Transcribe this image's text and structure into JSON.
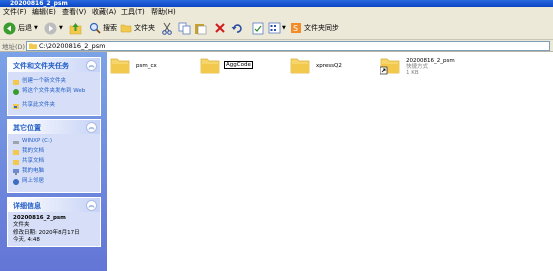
{
  "window": {
    "title": "20200816_2_psm"
  },
  "menu": [
    "文件(F)",
    "编辑(E)",
    "查看(V)",
    "收藏(A)",
    "工具(T)",
    "帮助(H)"
  ],
  "toolbar": {
    "back": "后退",
    "search": "搜索",
    "folders": "文件夹",
    "sync": "文件夹同步"
  },
  "address": {
    "label": "地址(D)",
    "path": "C:\\20200816_2_psm"
  },
  "left": {
    "tasks": {
      "title": "文件和文件夹任务",
      "items": [
        "创建一个新文件夹",
        "将这个文件夹发布到 Web",
        "共享此文件夹"
      ]
    },
    "places": {
      "title": "其它位置",
      "items": [
        "WINXP (C:)",
        "我的文档",
        "共享文档",
        "我的电脑",
        "网上邻居"
      ]
    },
    "details": {
      "title": "详细信息",
      "name": "20200816_2_psm",
      "type": "文件夹",
      "modified": "修改日期: 2020年8月17日",
      "time": "今天, 4:48"
    }
  },
  "files": [
    {
      "name": "psm_cx"
    },
    {
      "name": "AggCode"
    },
    {
      "name": "xpressQ2"
    },
    {
      "name": "20200816_2_psm",
      "sub1": "快捷方式",
      "sub2": "1 KB"
    }
  ]
}
